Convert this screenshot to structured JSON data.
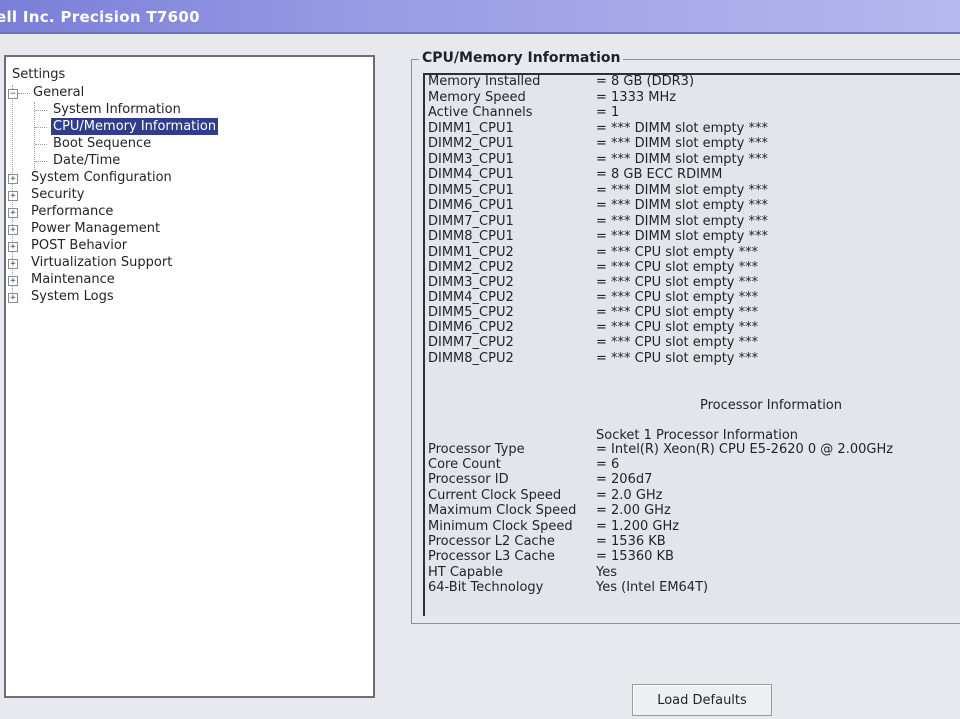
{
  "window": {
    "title": "ell Inc. Precision T7600"
  },
  "tree": {
    "root": "Settings",
    "general": "General",
    "general_children": [
      "System Information",
      "CPU/Memory Information",
      "Boot Sequence",
      "Date/Time"
    ],
    "selected": "CPU/Memory Information",
    "sections": [
      "System Configuration",
      "Security",
      "Performance",
      "Power Management",
      "POST Behavior",
      "Virtualization Support",
      "Maintenance",
      "System Logs"
    ]
  },
  "info": {
    "group_title": "CPU/Memory Information",
    "memory": [
      {
        "label": "Memory Installed",
        "value": "= 8 GB (DDR3)"
      },
      {
        "label": "Memory Speed",
        "value": "= 1333 MHz"
      },
      {
        "label": "Active Channels",
        "value": "= 1"
      },
      {
        "label": "DIMM1_CPU1",
        "value": "= *** DIMM slot empty ***"
      },
      {
        "label": "DIMM2_CPU1",
        "value": "= *** DIMM slot empty ***"
      },
      {
        "label": "DIMM3_CPU1",
        "value": "= *** DIMM slot empty ***"
      },
      {
        "label": "DIMM4_CPU1",
        "value": "= 8 GB ECC RDIMM"
      },
      {
        "label": "DIMM5_CPU1",
        "value": "= *** DIMM slot empty ***"
      },
      {
        "label": "DIMM6_CPU1",
        "value": "= *** DIMM slot empty ***"
      },
      {
        "label": "DIMM7_CPU1",
        "value": "= *** DIMM slot empty ***"
      },
      {
        "label": "DIMM8_CPU1",
        "value": "= *** DIMM slot empty ***"
      },
      {
        "label": "DIMM1_CPU2",
        "value": "= *** CPU slot empty ***"
      },
      {
        "label": "DIMM2_CPU2",
        "value": "= *** CPU slot empty ***"
      },
      {
        "label": "DIMM3_CPU2",
        "value": "= *** CPU slot empty ***"
      },
      {
        "label": "DIMM4_CPU2",
        "value": "= *** CPU slot empty ***"
      },
      {
        "label": "DIMM5_CPU2",
        "value": "= *** CPU slot empty ***"
      },
      {
        "label": "DIMM6_CPU2",
        "value": "= *** CPU slot empty ***"
      },
      {
        "label": "DIMM7_CPU2",
        "value": "= *** CPU slot empty ***"
      },
      {
        "label": "DIMM8_CPU2",
        "value": "= *** CPU slot empty ***"
      }
    ],
    "processor_header": "Processor Information",
    "socket_header": "Socket 1 Processor Information",
    "processor": [
      {
        "label": "Processor Type",
        "value": "= Intel(R) Xeon(R) CPU E5-2620 0 @ 2.00GHz"
      },
      {
        "label": "Core Count",
        "value": "= 6"
      },
      {
        "label": "Processor ID",
        "value": "= 206d7"
      },
      {
        "label": "Current Clock Speed",
        "value": "= 2.0 GHz"
      },
      {
        "label": "Maximum Clock Speed",
        "value": "= 2.00 GHz"
      },
      {
        "label": "Minimum Clock Speed",
        "value": "= 1.200 GHz"
      },
      {
        "label": "Processor L2 Cache",
        "value": "= 1536 KB"
      },
      {
        "label": "Processor L3 Cache",
        "value": "= 15360 KB"
      },
      {
        "label": "HT Capable",
        "value": "Yes"
      },
      {
        "label": "64-Bit Technology",
        "value": "Yes (Intel EM64T)"
      }
    ]
  },
  "buttons": {
    "load_defaults": "Load Defaults"
  }
}
